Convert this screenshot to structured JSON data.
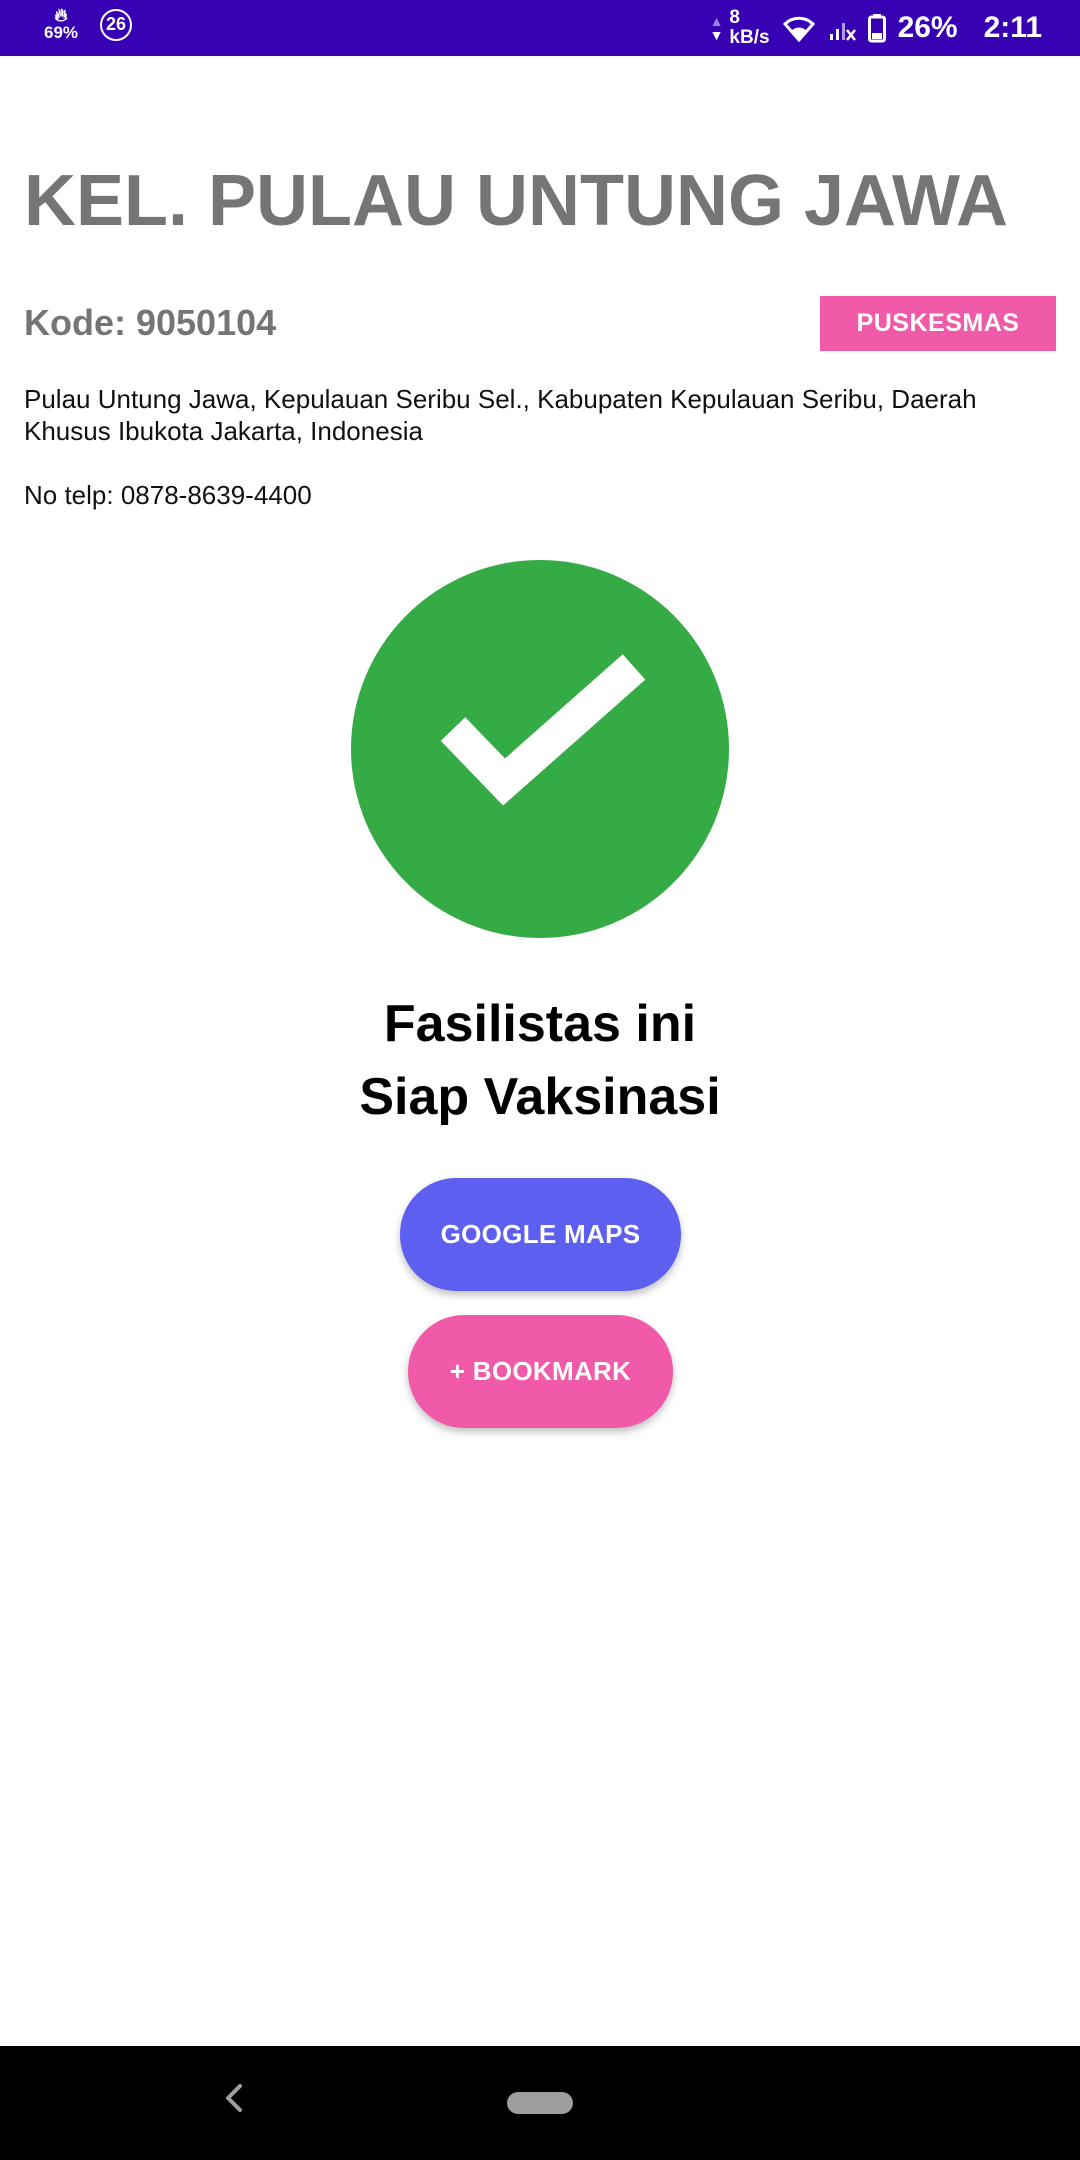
{
  "status_bar": {
    "fire_percent": "69%",
    "notification_count": "26",
    "speed_value": "8",
    "speed_unit": "kB/s",
    "battery_percent": "26%",
    "time": "2:11",
    "background_color": "#3700b3"
  },
  "facility": {
    "name": "KEL. PULAU UNTUNG JAWA",
    "code_label": "Kode: 9050104",
    "type_badge": "PUSKESMAS",
    "address": "Pulau Untung Jawa, Kepulauan Seribu Sel., Kabupaten Kepulauan Seribu, Daerah Khusus Ibukota Jakarta, Indonesia",
    "phone": "No telp: 0878-8639-4400"
  },
  "status": {
    "icon": "check-circle-icon",
    "icon_color": "#34ab44",
    "line1": "Fasilistas ini",
    "line2": "Siap Vaksinasi"
  },
  "actions": {
    "maps_label": "GOOGLE MAPS",
    "maps_color": "#5c5ff0",
    "bookmark_label": "+ BOOKMARK",
    "bookmark_color": "#f05aa8"
  }
}
